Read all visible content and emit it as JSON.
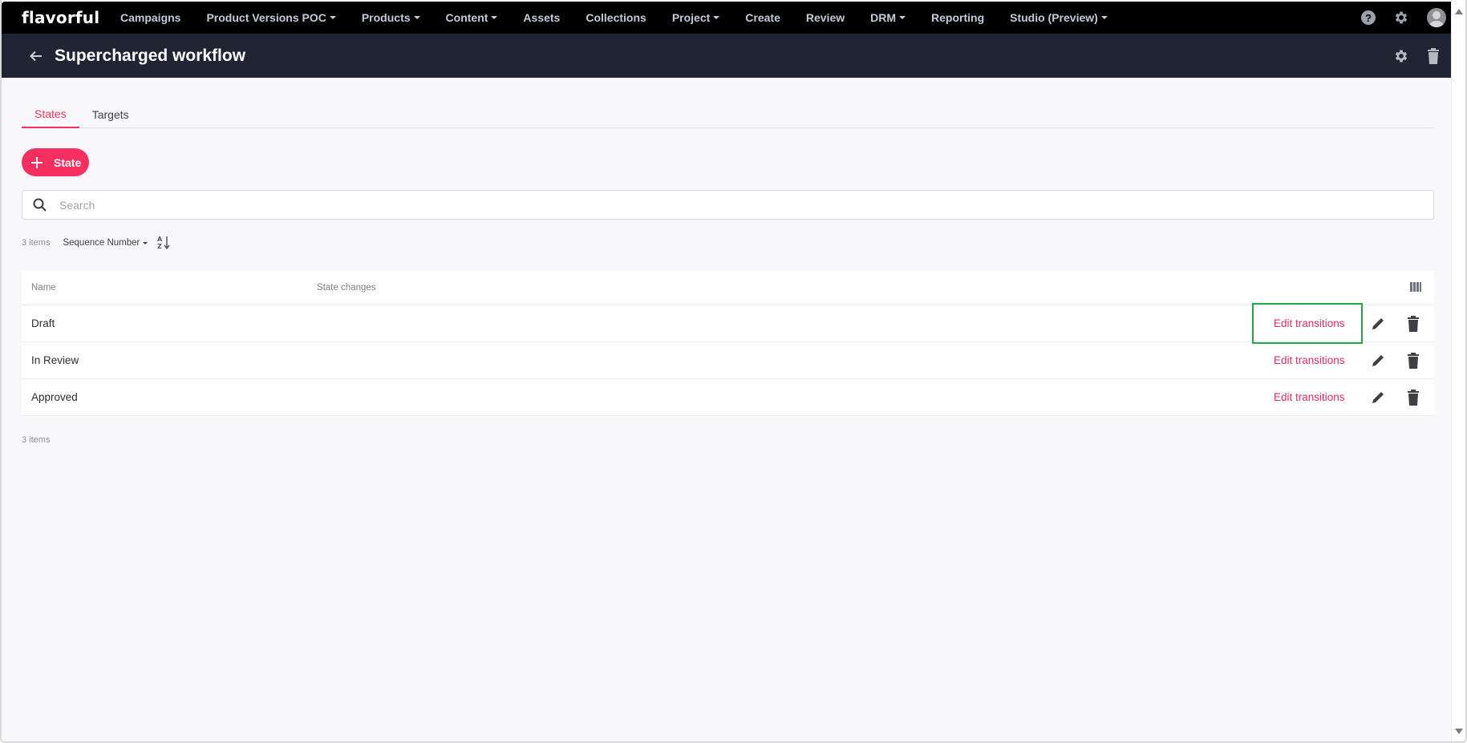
{
  "app": {
    "logo": "flavorful"
  },
  "topnav": {
    "items": [
      {
        "label": "Campaigns",
        "dropdown": false
      },
      {
        "label": "Product Versions POC",
        "dropdown": true
      },
      {
        "label": "Products",
        "dropdown": true
      },
      {
        "label": "Content",
        "dropdown": true
      },
      {
        "label": "Assets",
        "dropdown": false
      },
      {
        "label": "Collections",
        "dropdown": false
      },
      {
        "label": "Project",
        "dropdown": true
      },
      {
        "label": "Create",
        "dropdown": false
      },
      {
        "label": "Review",
        "dropdown": false
      },
      {
        "label": "DRM",
        "dropdown": true
      },
      {
        "label": "Reporting",
        "dropdown": false
      },
      {
        "label": "Studio (Preview)",
        "dropdown": true
      }
    ],
    "help_glyph": "?",
    "icons": [
      "help-icon",
      "gear-icon",
      "avatar-icon"
    ]
  },
  "header": {
    "title": "Supercharged workflow",
    "icons": [
      "back-arrow-icon",
      "gear-icon",
      "trash-icon"
    ]
  },
  "tabs": [
    {
      "label": "States",
      "active": true
    },
    {
      "label": "Targets",
      "active": false
    }
  ],
  "toolbar": {
    "add_button_label": "State",
    "search_placeholder": "Search",
    "search_value": "",
    "items_count": "3 items",
    "sort_by": "Sequence Number",
    "sort_direction_icon": "sort-a-z-icon"
  },
  "table": {
    "columns": [
      "Name",
      "State changes"
    ],
    "rows": [
      {
        "name": "Draft",
        "state_changes": "",
        "action_label": "Edit transitions",
        "highlighted": true
      },
      {
        "name": "In Review",
        "state_changes": "",
        "action_label": "Edit transitions",
        "highlighted": false
      },
      {
        "name": "Approved",
        "state_changes": "",
        "action_label": "Edit transitions",
        "highlighted": false
      }
    ],
    "footer_count": "3 items"
  },
  "colors": {
    "accent": "#f72f61",
    "link": "#d8305e",
    "highlight": "#22a74a",
    "topnav_bg": "#000000",
    "header_bg": "#202533"
  }
}
